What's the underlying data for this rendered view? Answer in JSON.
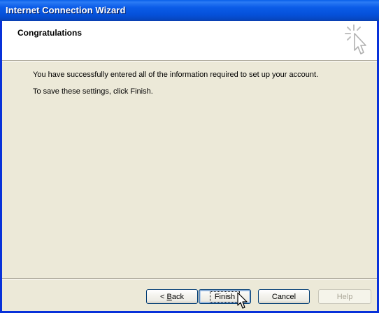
{
  "window": {
    "title": "Internet Connection Wizard"
  },
  "header": {
    "title": "Congratulations",
    "icon": "wizard-cursor-sparkle-icon"
  },
  "content": {
    "line1": "You have successfully entered all of the information required to set up your account.",
    "line2": "To save these settings, click Finish."
  },
  "buttons": {
    "back_prefix": "< ",
    "back_mnemonic": "B",
    "back_suffix": "ack",
    "finish": "Finish",
    "cancel": "Cancel",
    "help": "Help"
  },
  "colors": {
    "titlebar": "#0551DA",
    "border": "#0831D9",
    "dialog_bg": "#ECE9D8",
    "header_bg": "#FFFFFF"
  }
}
